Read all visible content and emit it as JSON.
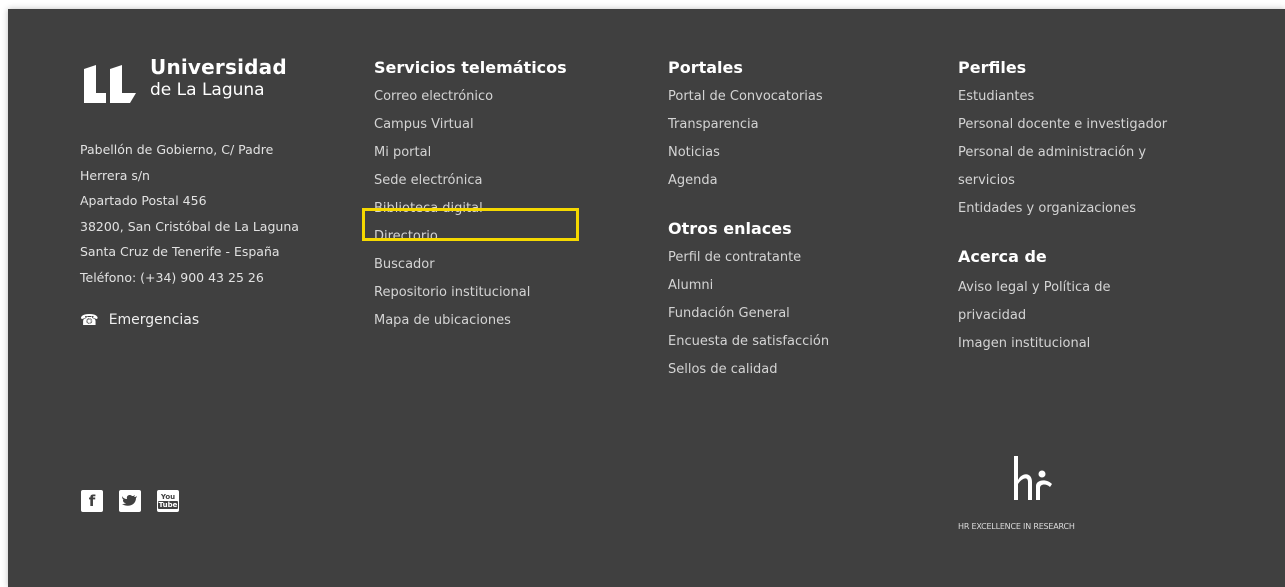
{
  "university": {
    "name_line1": "Universidad",
    "name_line2": "de La Laguna"
  },
  "address": {
    "lines": [
      "Pabellón de Gobierno, C/ Padre",
      "Herrera s/n",
      "Apartado Postal 456",
      "38200, San Cristóbal de La Laguna",
      "Santa Cruz de Tenerife - España",
      "Teléfono: (+34) 900 43 25 26"
    ]
  },
  "emergency": {
    "label": "Emergencias",
    "icon": "phone-ring-icon"
  },
  "social": [
    {
      "label": "f",
      "icon": "facebook-icon"
    },
    {
      "label": "t",
      "icon": "twitter-icon"
    },
    {
      "label": "You Tube",
      "icon": "youtube-icon"
    }
  ],
  "servicios": {
    "title": "Servicios telemáticos",
    "items": [
      "Correo electrónico",
      "Campus Virtual",
      "Mi portal",
      "Sede electrónica",
      "Biblioteca digital",
      "Directorio",
      "Buscador",
      "Repositorio institucional",
      "Mapa de ubicaciones"
    ]
  },
  "portales": {
    "title": "Portales",
    "items": [
      "Portal de Convocatorias",
      "Transparencia",
      "Noticias",
      "Agenda"
    ]
  },
  "otros": {
    "title": "Otros enlaces",
    "items": [
      "Perfil de contratante",
      "Alumni",
      "Fundación General",
      "Encuesta de satisfacción",
      "Sellos de calidad"
    ]
  },
  "perfiles": {
    "title": "Perfiles",
    "items": [
      "Estudiantes",
      "Personal docente e investigador",
      "Personal de administración y",
      "servicios",
      "Entidades y organizaciones"
    ]
  },
  "acerca": {
    "title": "Acerca de",
    "items": [
      "Aviso legal y Política de",
      "privacidad",
      "Imagen institucional"
    ]
  },
  "hr": {
    "caption": "HR EXCELLENCE IN RESEARCH"
  },
  "colors": {
    "background": "#404040",
    "highlight": "#f5d800",
    "text": "#d4d4d4"
  }
}
